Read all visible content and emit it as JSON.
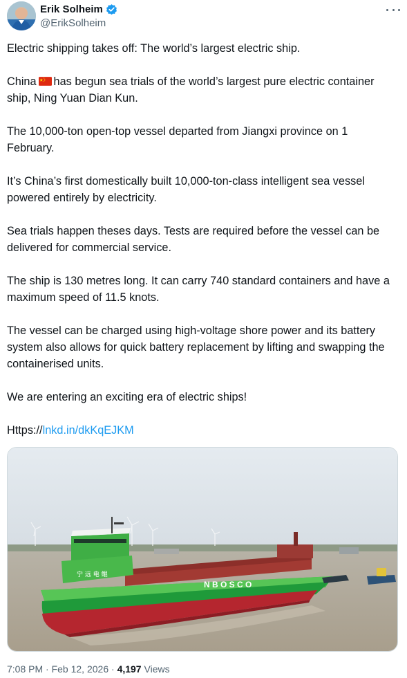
{
  "author": {
    "display_name": "Erik Solheim",
    "handle": "@ErikSolheim",
    "verified": true,
    "verified_color": "#1d9bf0"
  },
  "tweet": {
    "p1": "Electric shipping takes off: The world’s largest electric ship.",
    "p2_before_flag": "China",
    "p2_flag": "china-flag-emoji",
    "p2_after_flag": "has begun sea trials of the world’s largest pure electric container ship, Ning Yuan Dian Kun.",
    "p3": "The 10,000-ton open-top vessel departed from Jiangxi province on 1 February.",
    "p4": "It’s China’s first domestically built 10,000-ton-class intelligent sea vessel powered entirely by electricity.",
    "p5": "Sea trials happen theses days. Tests are required before the vessel can be delivered for commercial service.",
    "p6": "The ship is 130 metres long. It can carry 740 standard containers and have a maximum speed of 11.5 knots.",
    "p7": "The vessel can be charged using high-voltage shore power and its battery system also allows for quick battery replacement by lifting and swapping the containerised units.",
    "p8": "We are entering an exciting era of electric ships!",
    "link_prefix": "Https://",
    "link_text": "lnkd.in/dkKqEJKM",
    "link_color": "#1d9bf0"
  },
  "media": {
    "hull_lettering": "N B O S C O",
    "bridge_lettering": "宁 远 电 鲲"
  },
  "meta": {
    "time": "7:08 PM",
    "separator": "·",
    "date": "Feb 12, 2026",
    "views_count": "4,197",
    "views_label": "Views"
  },
  "icons": {
    "more": "more-horizontal-icon",
    "verified": "verified-badge-icon"
  }
}
